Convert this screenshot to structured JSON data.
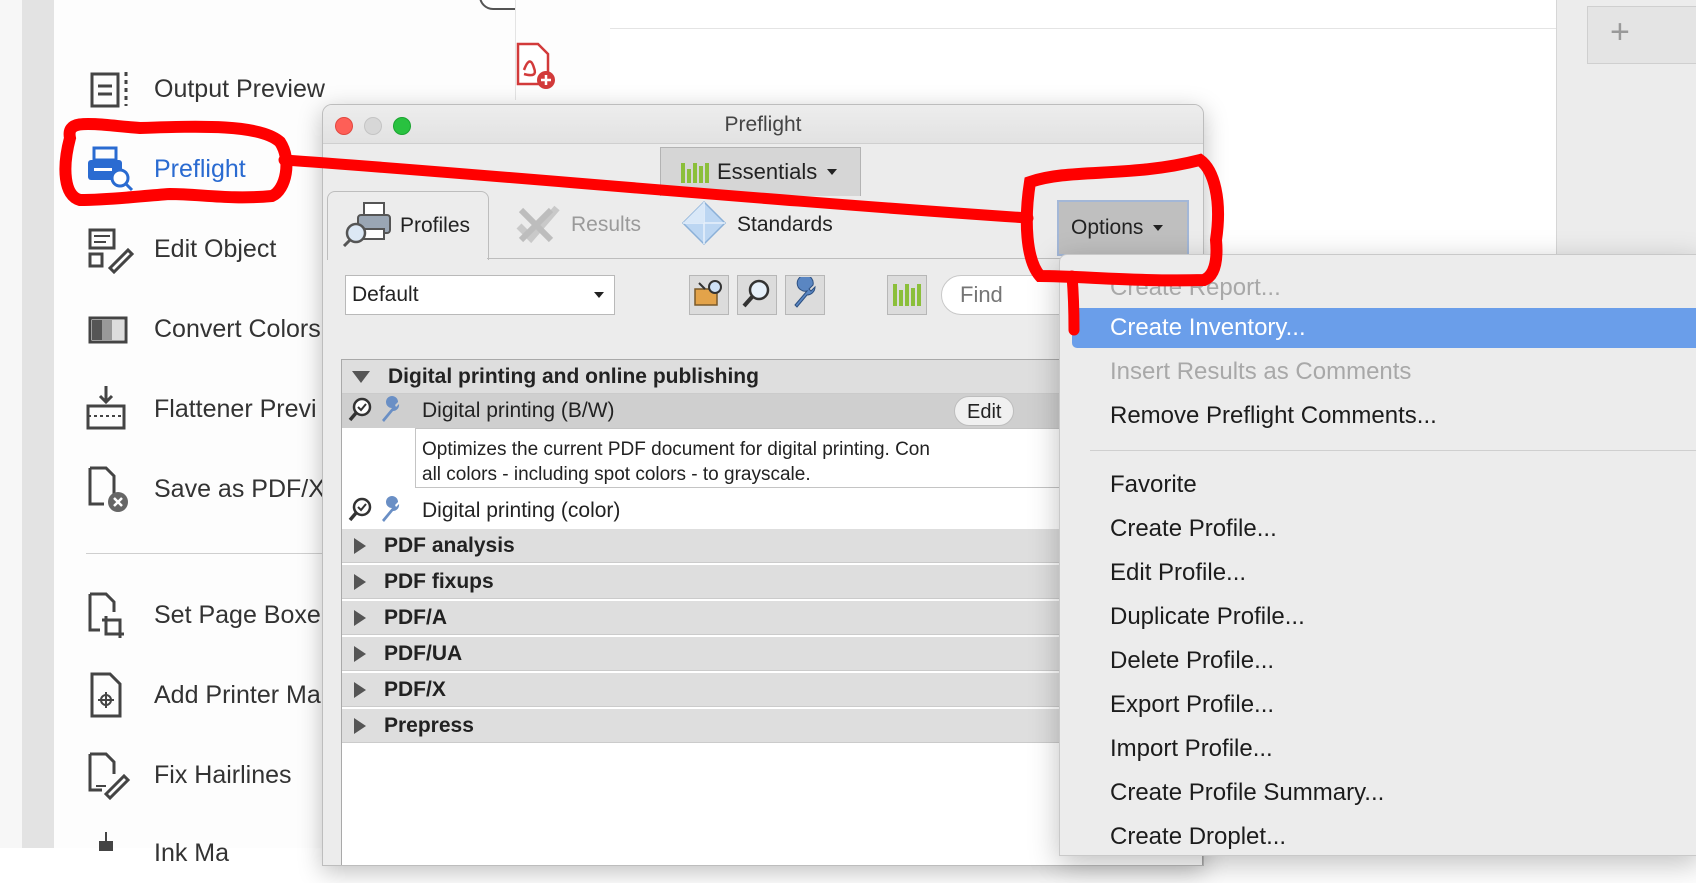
{
  "tools_panel": {
    "items": [
      {
        "label": "Output Preview",
        "icon": "output-preview-icon"
      },
      {
        "label": "Preflight",
        "icon": "preflight-icon"
      },
      {
        "label": "Edit Object",
        "icon": "edit-object-icon"
      },
      {
        "label": "Convert Colors",
        "icon": "convert-colors-icon"
      },
      {
        "label": "Flattener Previ",
        "icon": "flattener-preview-icon"
      },
      {
        "label": "Save as PDF/X",
        "icon": "save-as-pdfx-icon"
      },
      {
        "label": "Set Page Boxe",
        "icon": "set-page-boxes-icon"
      },
      {
        "label": "Add Printer Ma",
        "icon": "add-printer-marks-icon"
      },
      {
        "label": "Fix Hairlines",
        "icon": "fix-hairlines-icon"
      },
      {
        "label": "Ink Ma",
        "icon": "ink-manager-icon"
      }
    ]
  },
  "doc_area": {
    "plus_label": "+"
  },
  "preflight": {
    "window_title": "Preflight",
    "essentials_label": "Essentials",
    "tabs": [
      {
        "label": "Profiles",
        "icon": "profiles-printer-icon",
        "state": "active"
      },
      {
        "label": "Results",
        "icon": "results-icon",
        "state": "disabled"
      },
      {
        "label": "Standards",
        "icon": "standards-diamond-icon",
        "state": "normal"
      }
    ],
    "options_label": "Options",
    "profile_select_value": "Default",
    "find_placeholder": "Find",
    "groups": [
      {
        "label": "Digital printing and online publishing",
        "expanded": true
      },
      {
        "label": "PDF analysis",
        "expanded": false
      },
      {
        "label": "PDF fixups",
        "expanded": false
      },
      {
        "label": "PDF/A",
        "expanded": false
      },
      {
        "label": "PDF/UA",
        "expanded": false
      },
      {
        "label": "PDF/X",
        "expanded": false
      },
      {
        "label": "Prepress",
        "expanded": false
      }
    ],
    "profiles": [
      {
        "label": "Digital printing (B/W)",
        "selected": true,
        "edit_label": "Edit",
        "description_line1": "Optimizes the current PDF document for digital printing. Con",
        "description_line2": "all colors - including spot colors - to grayscale."
      },
      {
        "label": "Digital printing (color)",
        "selected": false
      }
    ]
  },
  "options_menu": {
    "items": [
      {
        "label": "Create Report...",
        "enabled": false
      },
      {
        "label": "Create Inventory...",
        "enabled": true,
        "highlighted": true
      },
      {
        "label": "Insert Results as Comments",
        "enabled": false
      },
      {
        "label": "Remove Preflight Comments...",
        "enabled": true
      },
      {
        "label": "Favorite",
        "enabled": true
      },
      {
        "label": "Create Profile...",
        "enabled": true
      },
      {
        "label": "Edit Profile...",
        "enabled": true
      },
      {
        "label": "Duplicate Profile...",
        "enabled": true
      },
      {
        "label": "Delete Profile...",
        "enabled": true
      },
      {
        "label": "Export Profile...",
        "enabled": true
      },
      {
        "label": "Import Profile...",
        "enabled": true
      },
      {
        "label": "Create Profile Summary...",
        "enabled": true
      },
      {
        "label": "Create Droplet...",
        "enabled": true
      }
    ]
  },
  "colors": {
    "accent": "#2a6bd1",
    "menu_highlight": "#6a9eea",
    "annotation_red": "#ff0000",
    "chart_green": "#8bbf3a"
  }
}
